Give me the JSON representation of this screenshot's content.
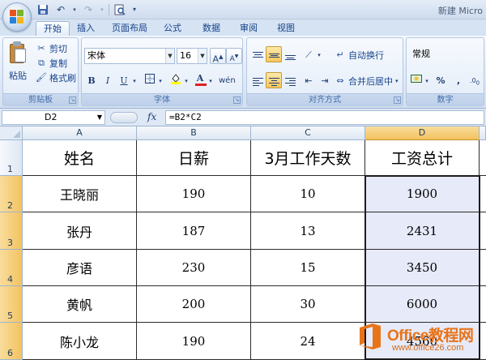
{
  "window": {
    "title": "新建 Micro"
  },
  "quick_access": [
    {
      "name": "save-icon",
      "glyph": "💾"
    },
    {
      "name": "undo-icon",
      "glyph": "↶"
    },
    {
      "name": "redo-icon",
      "glyph": "↷"
    },
    {
      "name": "print-preview-icon",
      "glyph": "🔍"
    },
    {
      "name": "customize-qat-icon",
      "glyph": "▾"
    }
  ],
  "tabs": [
    "开始",
    "插入",
    "页面布局",
    "公式",
    "数据",
    "审阅",
    "视图"
  ],
  "active_tab": "开始",
  "ribbon": {
    "clipboard": {
      "label": "剪贴板",
      "paste": "粘贴",
      "cut": "剪切",
      "copy": "复制",
      "format_painter": "格式刷"
    },
    "font": {
      "label": "字体",
      "font_name": "宋体",
      "font_size": "16",
      "bold": "B",
      "italic": "I",
      "underline": "U"
    },
    "alignment": {
      "label": "对齐方式",
      "wrap_text": "自动换行",
      "merge_center": "合并后居中"
    },
    "number": {
      "label": "数字",
      "format": "常规",
      "percent": "%",
      "comma": ","
    }
  },
  "formula_bar": {
    "cell_ref": "D2",
    "formula": "=B2*C2",
    "fx": "fx"
  },
  "sheet": {
    "columns": [
      "A",
      "B",
      "C",
      "D"
    ],
    "selected_column": "D",
    "row_numbers": [
      "1",
      "2",
      "3",
      "4",
      "5",
      "6"
    ],
    "header": [
      "姓名",
      "日薪",
      "3月工作天数",
      "工资总计"
    ],
    "rows": [
      [
        "王晓丽",
        "190",
        "10",
        "1900"
      ],
      [
        "张丹",
        "187",
        "13",
        "2431"
      ],
      [
        "彦语",
        "230",
        "15",
        "3450"
      ],
      [
        "黄帆",
        "200",
        "30",
        "6000"
      ],
      [
        "陈小龙",
        "190",
        "24",
        "4560"
      ]
    ]
  },
  "watermark": {
    "brand": "Office教程网",
    "url": "www.office26.com"
  },
  "colors": {
    "selection_header": "#f3c25f",
    "selected_cells": "#e7eaf8",
    "brand_orange": "#e8741a",
    "ribbon_blue": "#15428b"
  }
}
